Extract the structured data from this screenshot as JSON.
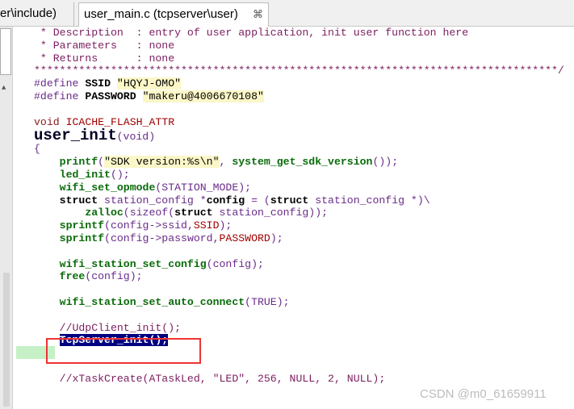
{
  "tabs": [
    {
      "label": "er\\include)",
      "active": false
    },
    {
      "label": "user_main.c (tcpserver\\user)",
      "active": true
    }
  ],
  "tab_close_glyph": "⌘",
  "code": {
    "comment_description": " * Description  : entry of user application, init user function here",
    "comment_parameters": " * Parameters   : none",
    "comment_returns": " * Returns      : none",
    "stars_line": "**********************************************************************************/",
    "define_ssid_kw": "#define",
    "define_ssid_name": "SSID",
    "define_ssid_value": "\"HQYJ-OMO\"",
    "define_pass_kw": "#define",
    "define_pass_name": "PASSWORD",
    "define_pass_value": "\"makeru@4006670108\"",
    "void_kw": "void",
    "attr": "ICACHE_FLASH_ATTR",
    "func_name": "user_init",
    "func_params": "(void)",
    "open_brace": "{",
    "l1_fn": "printf",
    "l1_p1": "(",
    "l1_str": "\"SDK version:%s\\n\"",
    "l1_p2": ", ",
    "l1_fn2": "system_get_sdk_version",
    "l1_p3": "());",
    "l2_fn": "led_init",
    "l2_p": "();",
    "l3_fn": "wifi_set_opmode",
    "l3_p": "(STATION_MODE);",
    "l4_kw": "struct",
    "l4_a": " station_config *",
    "l4_var": "config",
    "l4_b": " = (",
    "l4_kw2": "struct",
    "l4_c": " station_config *)\\",
    "l5_fn": "zalloc",
    "l5_a": "(sizeof(",
    "l5_kw": "struct",
    "l5_b": " station_config));",
    "l6_fn": "sprintf",
    "l6_a": "(config->ssid,",
    "l6_macro": "SSID",
    "l6_b": ");",
    "l7_fn": "sprintf",
    "l7_a": "(config->password,",
    "l7_macro": "PASSWORD",
    "l7_b": ");",
    "l8_fn": "wifi_station_set_config",
    "l8_p": "(config);",
    "l9_fn": "free",
    "l9_p": "(config);",
    "l10_fn": "wifi_station_set_auto_connect",
    "l10_p": "(TRUE);",
    "l11_comment": "//UdpClient_init();",
    "l12_selected": "TcpServer_init();",
    "l13_comment": "//xTaskCreate(ATaskLed, \"LED\", 256, NULL, 2, NULL);"
  },
  "watermark": "CSDN @m0_61659911",
  "colors": {
    "selection": "#000080",
    "highlight_box": "#e33333",
    "function": "#0a6b0a",
    "string_bg": "#fbf7c8"
  }
}
